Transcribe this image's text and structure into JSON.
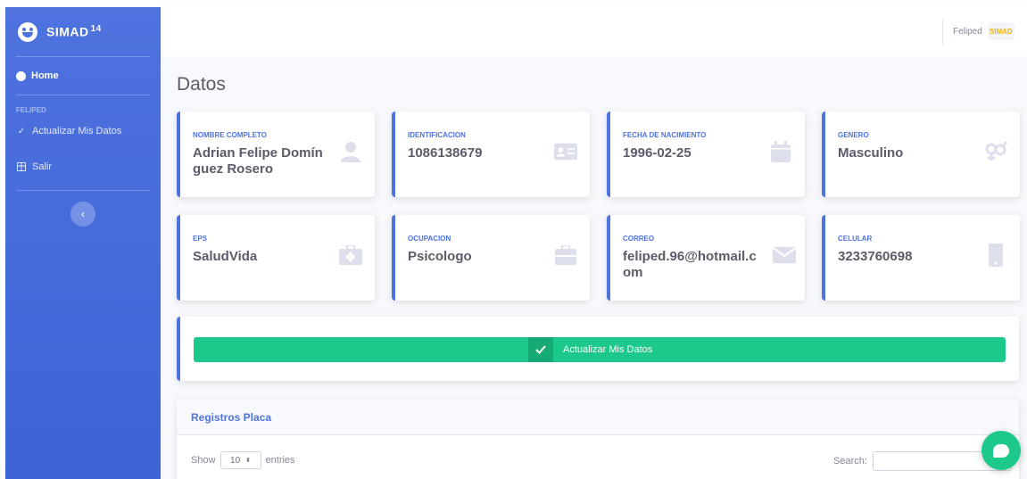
{
  "brand": {
    "name": "SIMAD",
    "sup": "14"
  },
  "sidebar": {
    "home_label": "Home",
    "section_heading": "FELIPED",
    "items": [
      {
        "label": "Actualizar Mis Datos",
        "icon": "check-icon"
      },
      {
        "label": "Salir",
        "icon": "table-icon"
      }
    ],
    "toggle_icon": "chevron-left-icon"
  },
  "topbar": {
    "user_name": "Feliped",
    "avatar_text": "SIMAD"
  },
  "page": {
    "title": "Datos"
  },
  "cards": [
    {
      "label": "NOMBRE COMPLETO",
      "value": "Adrian Felipe Domínguez Rosero",
      "icon": "user-icon"
    },
    {
      "label": "IDENTIFICACION",
      "value": "1086138679",
      "icon": "id-card-icon"
    },
    {
      "label": "FECHA DE NACIMIENTO",
      "value": "1996-02-25",
      "icon": "calendar-icon"
    },
    {
      "label": "GENERO",
      "value": "Masculino",
      "icon": "gender-icon"
    },
    {
      "label": "EPS",
      "value": "SaludVida",
      "icon": "medkit-icon"
    },
    {
      "label": "OCUPACION",
      "value": "Psicologo",
      "icon": "briefcase-icon"
    },
    {
      "label": "CORREO",
      "value": "feliped.96@hotmail.com",
      "icon": "envelope-icon"
    },
    {
      "label": "CELULAR",
      "value": "3233760698",
      "icon": "mobile-icon"
    }
  ],
  "update_button": {
    "label": "Actualizar Mis Datos"
  },
  "registros": {
    "title": "Registros Placa",
    "show_label": "Show",
    "entries_value": "10",
    "entries_label": "entries",
    "search_label": "Search:"
  },
  "colors": {
    "primary": "#4e73df",
    "success": "#1cc88a",
    "text": "#5a5c69"
  }
}
